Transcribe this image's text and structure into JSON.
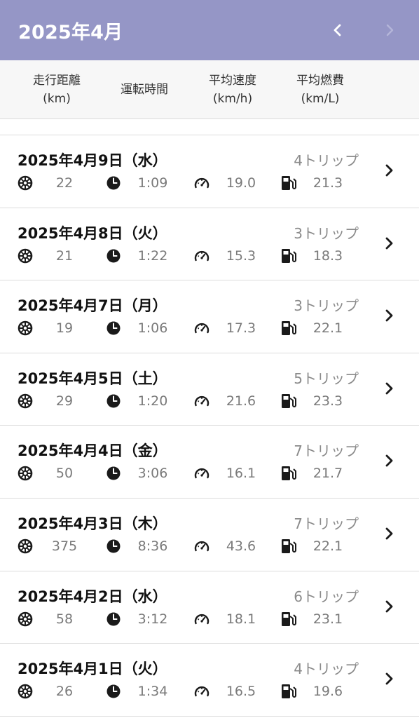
{
  "header": {
    "title": "2025年4月",
    "prev_icon": "chevron-left-icon",
    "next_icon": "chevron-right-icon",
    "background": "#9596c6"
  },
  "columns": [
    {
      "label": "走行距離\n(km)"
    },
    {
      "label": "運転時間"
    },
    {
      "label": "平均速度\n(km/h)"
    },
    {
      "label": "平均燃費\n(km/L)"
    }
  ],
  "rows": [
    {
      "date": "2025年4月9日（水）",
      "trips": "4トリップ",
      "distance": "22",
      "time": "1:09",
      "speed": "19.0",
      "economy": "21.3"
    },
    {
      "date": "2025年4月8日（火）",
      "trips": "3トリップ",
      "distance": "21",
      "time": "1:22",
      "speed": "15.3",
      "economy": "18.3"
    },
    {
      "date": "2025年4月7日（月）",
      "trips": "3トリップ",
      "distance": "19",
      "time": "1:06",
      "speed": "17.3",
      "economy": "22.1"
    },
    {
      "date": "2025年4月5日（土）",
      "trips": "5トリップ",
      "distance": "29",
      "time": "1:20",
      "speed": "21.6",
      "economy": "23.3"
    },
    {
      "date": "2025年4月4日（金）",
      "trips": "7トリップ",
      "distance": "50",
      "time": "3:06",
      "speed": "16.1",
      "economy": "21.7"
    },
    {
      "date": "2025年4月3日（木）",
      "trips": "7トリップ",
      "distance": "375",
      "time": "8:36",
      "speed": "43.6",
      "economy": "22.1"
    },
    {
      "date": "2025年4月2日（水）",
      "trips": "6トリップ",
      "distance": "58",
      "time": "3:12",
      "speed": "18.1",
      "economy": "23.1"
    },
    {
      "date": "2025年4月1日（火）",
      "trips": "4トリップ",
      "distance": "26",
      "time": "1:34",
      "speed": "16.5",
      "economy": "19.6"
    }
  ],
  "icons": {
    "distance": "tire-icon",
    "time": "clock-icon",
    "speed": "speedometer-icon",
    "economy": "fuel-pump-icon",
    "row_action": "chevron-right-icon"
  }
}
